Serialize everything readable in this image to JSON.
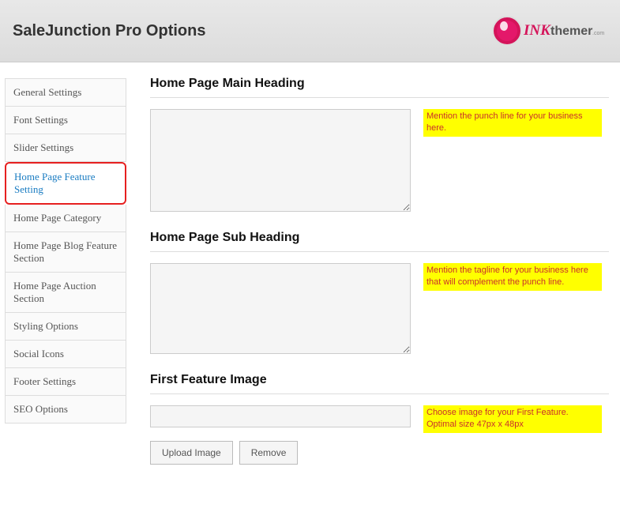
{
  "header": {
    "title": "SaleJunction Pro Options",
    "logo_text_prefix": "INK",
    "logo_text_suffix": ".com",
    "logo_main": "themer"
  },
  "sidebar": {
    "items": [
      {
        "label": "General Settings"
      },
      {
        "label": "Font Settings"
      },
      {
        "label": "Slider Settings"
      },
      {
        "label": "Home Page Feature Setting"
      },
      {
        "label": "Home Page Category"
      },
      {
        "label": "Home Page Blog Feature Section"
      },
      {
        "label": "Home Page Auction Section"
      },
      {
        "label": "Styling Options"
      },
      {
        "label": "Social Icons"
      },
      {
        "label": "Footer Settings"
      },
      {
        "label": "SEO Options"
      }
    ]
  },
  "content": {
    "section1": {
      "title": "Home Page Main Heading",
      "hint": "Mention the punch line for your business here."
    },
    "section2": {
      "title": "Home Page Sub Heading",
      "hint": "Mention the tagline for your business here that will complement the punch line."
    },
    "section3": {
      "title": "First Feature Image",
      "hint": "Choose image for your First Feature. Optimal size 47px x 48px",
      "upload_label": "Upload Image",
      "remove_label": "Remove"
    }
  }
}
